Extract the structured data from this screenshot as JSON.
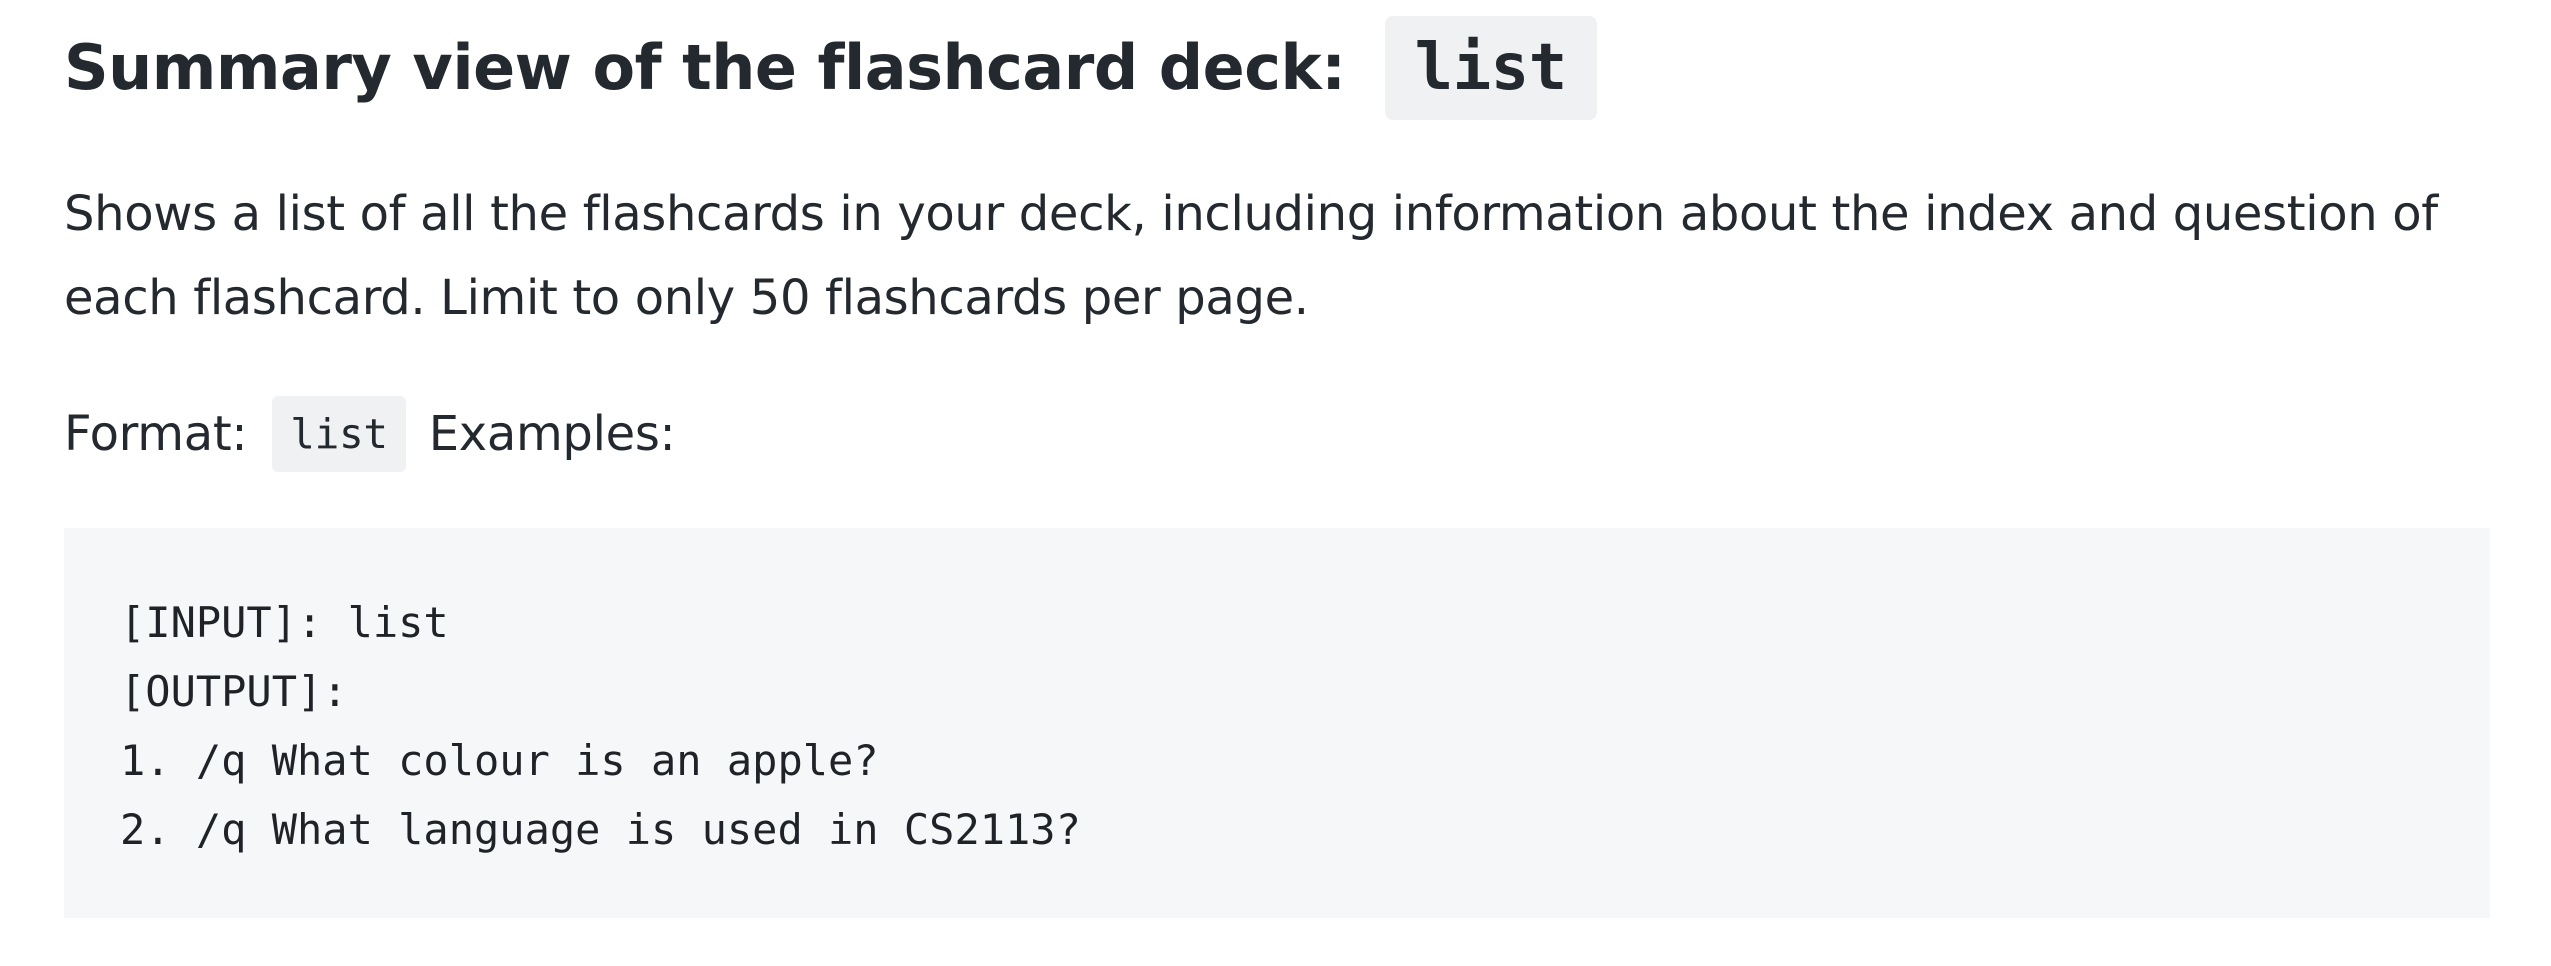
{
  "heading": {
    "text": "Summary view of the flashcard deck: ",
    "command": "list"
  },
  "description": "Shows a list of all the flashcards in your deck, including information about the index and question of each flashcard. Limit to only 50 flashcards per page.",
  "format": {
    "label": "Format: ",
    "command": "list",
    "examples_label": " Examples:"
  },
  "code_block": {
    "lines": [
      "[INPUT]: list",
      "[OUTPUT]:",
      "1. /q What colour is an apple?",
      "2. /q What language is used in CS2113?"
    ]
  }
}
